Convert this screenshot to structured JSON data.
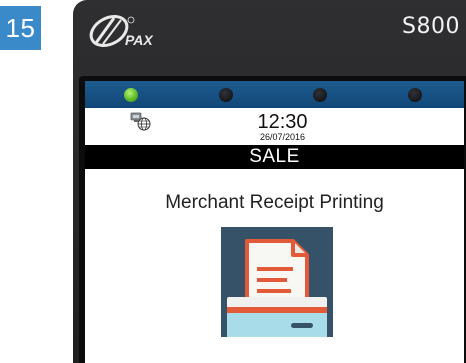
{
  "step": {
    "number": "15",
    "color": "#3a8ac9"
  },
  "device": {
    "brand": "PAX",
    "model": "S800",
    "body_color": "#2a2a2c"
  },
  "screen": {
    "leds": [
      {
        "state": "on",
        "color": "#5dbb2a"
      },
      {
        "state": "off"
      },
      {
        "state": "off"
      },
      {
        "state": "off"
      }
    ],
    "status": {
      "icon": "network-globe-icon",
      "time": "12:30",
      "date": "26/07/2016"
    },
    "title": "SALE",
    "message": "Merchant Receipt Printing",
    "illustration": "receipt-printer-icon"
  }
}
